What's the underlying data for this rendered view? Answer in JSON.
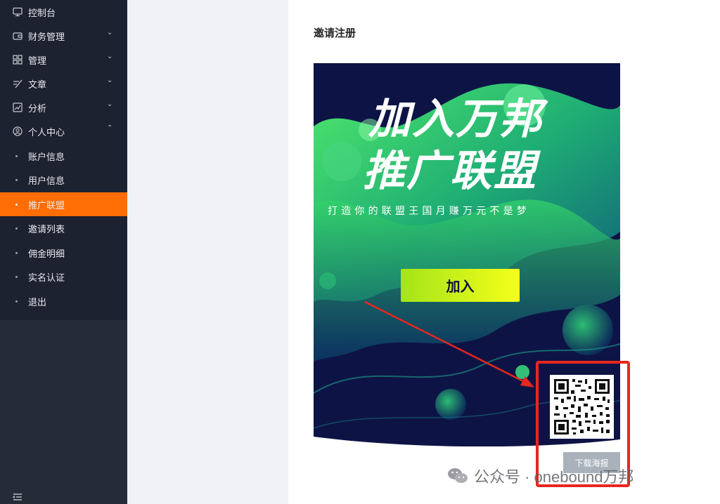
{
  "sidebar": {
    "items": [
      {
        "label": "控制台",
        "icon": "monitor-icon"
      },
      {
        "label": "财务管理",
        "icon": "wallet-icon"
      },
      {
        "label": "管理",
        "icon": "grid-icon"
      },
      {
        "label": "文章",
        "icon": "edit-icon"
      },
      {
        "label": "分析",
        "icon": "chart-icon"
      },
      {
        "label": "个人中心",
        "icon": "user-circle-icon"
      }
    ],
    "subitems": [
      {
        "label": "账户信息"
      },
      {
        "label": "用户信息"
      },
      {
        "label": "推广联盟",
        "active": true
      },
      {
        "label": "邀请列表"
      },
      {
        "label": "佣金明细"
      },
      {
        "label": "实名认证"
      },
      {
        "label": "退出"
      }
    ],
    "active_color": "#ff6d04"
  },
  "main": {
    "title": "邀请注册",
    "poster": {
      "headline_line1": "加入万邦",
      "headline_line2": "推广联盟",
      "slogan": "打造你的联盟王国月赚万元不是梦",
      "join_button": "加入"
    },
    "download_button": "下载海报"
  },
  "watermark": "公众号 · onebound万邦",
  "colors": {
    "highlight_box": "#e8271f",
    "poster_bg": "#0d1445",
    "poster_green": "#2ee06a"
  }
}
